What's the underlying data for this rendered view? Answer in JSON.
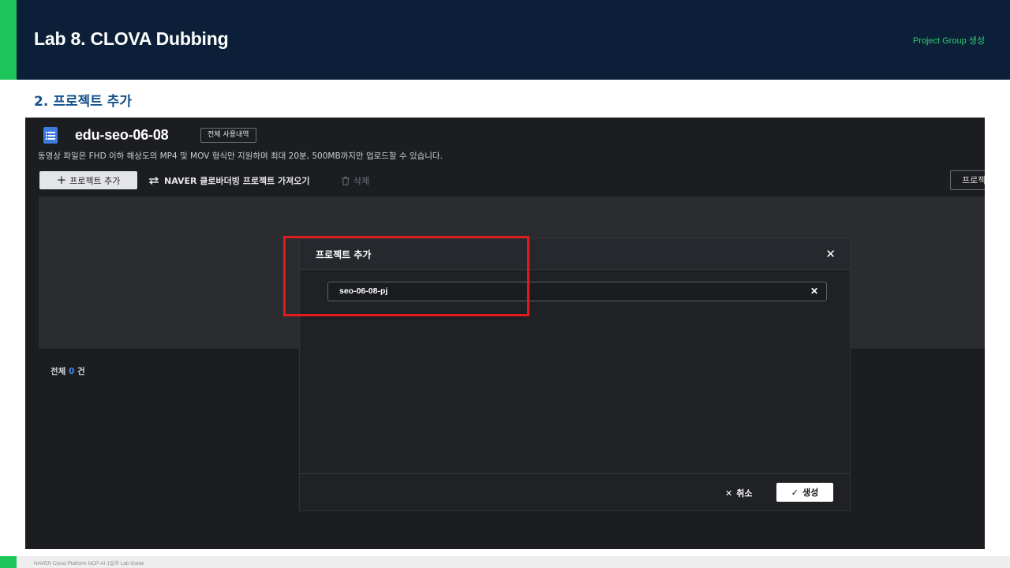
{
  "slide": {
    "title": "Lab 8. CLOVA Dubbing",
    "tag": "Project Group 생성",
    "section_title": "2. 프로젝트 추가",
    "footer": "NAVER Cloud Platform  NCP-AI 1일차 Lab Guide"
  },
  "workspace": {
    "name": "edu-seo-06-08",
    "usage_badge": "전체 사용내역",
    "notice": "동영상 파일은 FHD 이하 해상도의 MP4 및 MOV 형식만 지원하며 최대 20분, 500MB까지만 업로드할 수 있습니다."
  },
  "toolbar": {
    "add_project": "프로젝트 추가",
    "import_label": "NAVER 클로바더빙 프로젝트 가져오기",
    "delete_label": "삭제",
    "right_button": "프로젝"
  },
  "list": {
    "total_prefix": "전체",
    "total_count": "0",
    "total_suffix": "건"
  },
  "modal": {
    "title": "프로젝트 추가",
    "input_value": "seo-06-08-pj",
    "cancel_label": "취소",
    "create_label": "생성"
  },
  "colors": {
    "header_bg": "#0b2038",
    "accent_green": "#1ec55a",
    "section_blue": "#14508a",
    "highlight_red": "#e01b1b",
    "count_blue": "#3d8bf0"
  }
}
